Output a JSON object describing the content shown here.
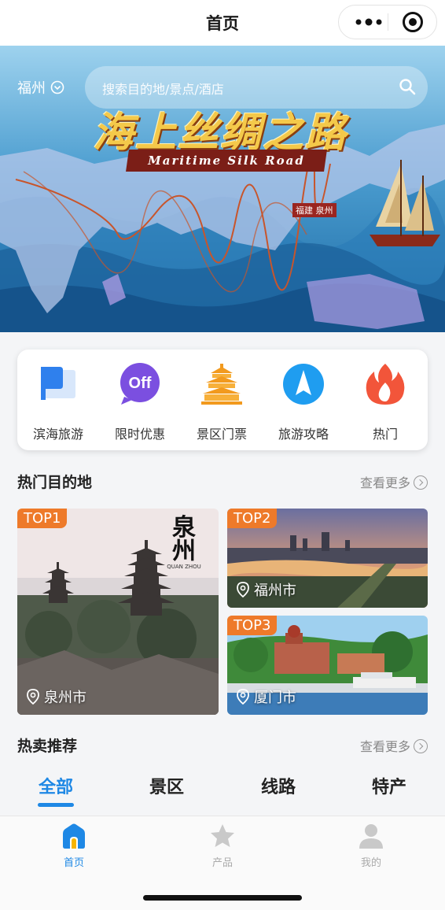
{
  "nav": {
    "title": "首页"
  },
  "banner": {
    "city": "福州",
    "search_placeholder": "搜索目的地/景点/酒店",
    "title": "海上丝绸之路",
    "subtitle": "Maritime Silk Road",
    "map_tag": "福建 泉州"
  },
  "quick_menu": [
    {
      "label": "滨海旅游",
      "icon": "flag-icon"
    },
    {
      "label": "限时优惠",
      "icon": "off-icon"
    },
    {
      "label": "景区门票",
      "icon": "temple-icon"
    },
    {
      "label": "旅游攻略",
      "icon": "navigation-icon"
    },
    {
      "label": "热门",
      "icon": "flame-icon"
    }
  ],
  "hot_destinations": {
    "title": "热门目的地",
    "more": "查看更多",
    "items": [
      {
        "rank": "TOP1",
        "city": "泉州市",
        "logo_text": "泉州",
        "logo_sub": "QUAN ZHOU"
      },
      {
        "rank": "TOP2",
        "city": "福州市"
      },
      {
        "rank": "TOP3",
        "city": "厦门市"
      }
    ]
  },
  "hot_sale": {
    "title": "热卖推荐",
    "more": "查看更多"
  },
  "tabs": [
    {
      "label": "全部",
      "active": true
    },
    {
      "label": "景区"
    },
    {
      "label": "线路"
    },
    {
      "label": "特产"
    }
  ],
  "tabbar": [
    {
      "label": "首页",
      "icon": "home-icon",
      "active": true
    },
    {
      "label": "产品",
      "icon": "star-icon"
    },
    {
      "label": "我的",
      "icon": "user-icon"
    }
  ],
  "colors": {
    "accent": "#1e88e5",
    "badge": "#ee7a2a"
  }
}
